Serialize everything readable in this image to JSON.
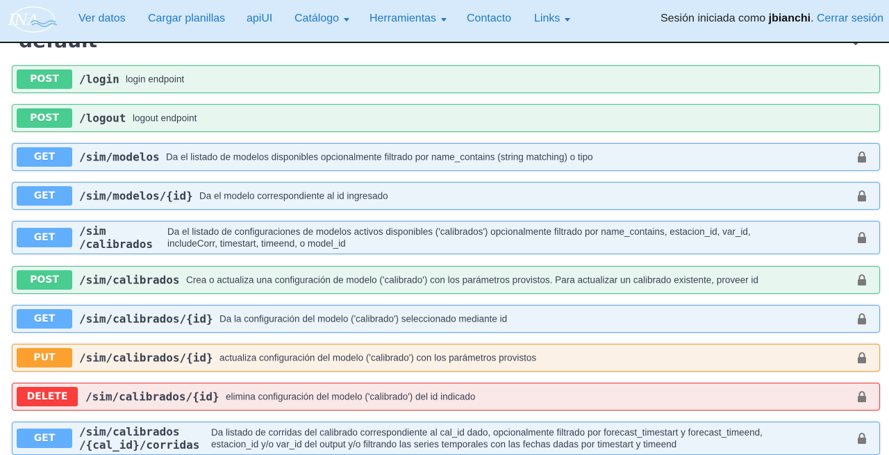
{
  "navbar": {
    "logo_text": "INA",
    "items": [
      {
        "label": "Ver datos"
      },
      {
        "label": "Cargar planillas"
      },
      {
        "label": "apiUI"
      },
      {
        "label": "Catálogo"
      },
      {
        "label": "Herramientas"
      },
      {
        "label": "Contacto"
      },
      {
        "label": "Links"
      }
    ],
    "session_prefix": "Sesión iniciada como",
    "username": "jbianchi",
    "logout_label": "Cerrar sesión"
  },
  "section": {
    "title": "default"
  },
  "operations": [
    {
      "method": "POST",
      "path": "/login",
      "desc": "login endpoint"
    },
    {
      "method": "POST",
      "path": "/logout",
      "desc": "logout endpoint"
    },
    {
      "method": "GET",
      "path": "/sim/modelos",
      "desc": "Da el listado de modelos disponibles opcionalmente filtrado por name_contains (string matching) o tipo"
    },
    {
      "method": "GET",
      "path": "/sim/modelos/{id}",
      "desc": "Da el modelo correspondiente al id ingresado"
    },
    {
      "method": "GET",
      "path_line1": "/sim",
      "path_line2": "/calibrados",
      "desc_line1": "Da el listado de configuraciones de modelos activos disponibles ('calibrados') opcionalmente filtrado por name_contains, estacion_id, var_id,",
      "desc_line2": "includeCorr, timestart, timeend, o model_id"
    },
    {
      "method": "POST",
      "path": "/sim/calibrados",
      "desc": "Crea o actualiza una configuración de modelo ('calibrado') con los parámetros provistos. Para actualizar un calibrado existente, proveer id"
    },
    {
      "method": "GET",
      "path": "/sim/calibrados/{id}",
      "desc": "Da la configuración del modelo ('calibrado') seleccionado mediante id"
    },
    {
      "method": "PUT",
      "path": "/sim/calibrados/{id}",
      "desc": "actualiza configuración del modelo ('calibrado') con los parámetros provistos"
    },
    {
      "method": "DELETE",
      "path": "/sim/calibrados/{id}",
      "desc": "elimina configuración del modelo ('calibrado') del id indicado"
    },
    {
      "method": "GET",
      "path_line1": "/sim/calibrados",
      "path_line2": "/{cal_id}/corridas",
      "desc_line1": "Da listado de corridas del calibrado correspondiente al cal_id dado, opcionalmente filtrado por forecast_timestart y forecast_timeend,",
      "desc_line2": "estacion_id y/o var_id del output y/o filtrando las series temporales con las fechas dadas por timestart y timeend"
    }
  ]
}
